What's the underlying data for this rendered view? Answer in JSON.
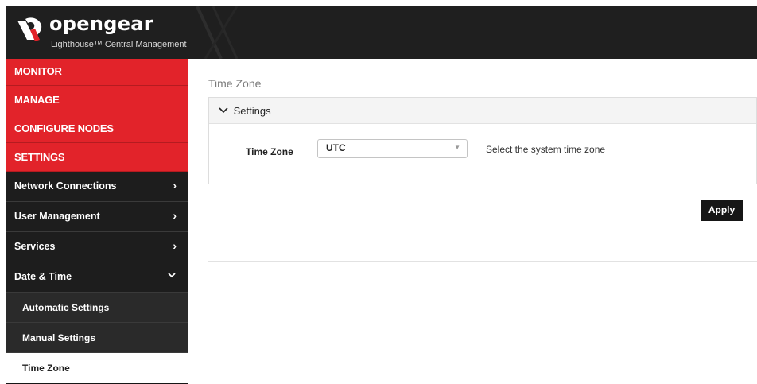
{
  "header": {
    "brand": "opengear",
    "subtitle": "Lighthouse™ Central Management",
    "bg_color": "#1f1f1f"
  },
  "sidebar": {
    "primary": [
      {
        "label": "MONITOR"
      },
      {
        "label": "MANAGE"
      },
      {
        "label": "CONFIGURE NODES"
      },
      {
        "label": "SETTINGS"
      }
    ],
    "sections": [
      {
        "label": "Network Connections",
        "icon": "chevron-right-icon"
      },
      {
        "label": "User Management",
        "icon": "chevron-right-icon"
      },
      {
        "label": "Services",
        "icon": "chevron-right-icon"
      },
      {
        "label": "Date & Time",
        "icon": "chevron-down-icon"
      }
    ],
    "subitems": [
      {
        "label": "Automatic Settings"
      },
      {
        "label": "Manual Settings"
      },
      {
        "label": "Time Zone",
        "active": true
      }
    ],
    "accent_color": "#e2232a"
  },
  "main": {
    "page_title": "Time Zone",
    "panel_title": "Settings",
    "timezone_label": "Time Zone",
    "timezone_value": "UTC",
    "timezone_help": "Select the system time zone",
    "apply_label": "Apply"
  },
  "glyphs": {
    "chevron_right": "›",
    "chevron_down": "⌄",
    "select_arrow": "▼"
  }
}
